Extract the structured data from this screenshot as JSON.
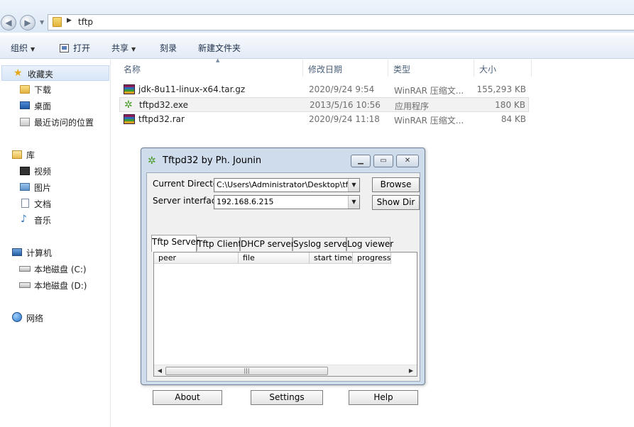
{
  "address": {
    "breadcrumb": "tftp",
    "folder_icon": "folder-icon"
  },
  "toolbar": {
    "organize": "组织",
    "open": "打开",
    "share": "共享",
    "burn": "刻录",
    "new_folder": "新建文件夹"
  },
  "sidebar": {
    "favorites": {
      "label": "收藏夹",
      "icon": "star-icon"
    },
    "favorites_items": [
      {
        "label": "下载",
        "icon": "downloads-folder-icon"
      },
      {
        "label": "桌面",
        "icon": "desktop-icon"
      },
      {
        "label": "最近访问的位置",
        "icon": "recent-places-icon"
      }
    ],
    "libraries": {
      "label": "库",
      "icon": "library-icon"
    },
    "library_items": [
      {
        "label": "视频",
        "icon": "video-icon"
      },
      {
        "label": "图片",
        "icon": "pictures-icon"
      },
      {
        "label": "文档",
        "icon": "documents-icon"
      },
      {
        "label": "音乐",
        "icon": "music-icon"
      }
    ],
    "computer": {
      "label": "计算机",
      "icon": "computer-icon"
    },
    "computer_items": [
      {
        "label": "本地磁盘 (C:)",
        "icon": "drive-c-icon"
      },
      {
        "label": "本地磁盘 (D:)",
        "icon": "drive-d-icon"
      }
    ],
    "network": {
      "label": "网络",
      "icon": "network-icon"
    }
  },
  "file_list": {
    "columns": {
      "name": "名称",
      "date": "修改日期",
      "type": "类型",
      "size": "大小"
    },
    "files": [
      {
        "name": "jdk-8u11-linux-x64.tar.gz",
        "date": "2020/9/24 9:54",
        "type": "WinRAR 压缩文...",
        "size": "155,293 KB",
        "icon": "winrar-archive-icon"
      },
      {
        "name": "tftpd32.exe",
        "date": "2013/5/16 10:56",
        "type": "应用程序",
        "size": "180 KB",
        "icon": "tftpd32-exe-icon"
      },
      {
        "name": "tftpd32.rar",
        "date": "2020/9/24 11:18",
        "type": "WinRAR 压缩文...",
        "size": "84 KB",
        "icon": "winrar-archive-icon"
      }
    ]
  },
  "dialog": {
    "title": "Tftpd32 by Ph. Jounin",
    "current_directory_label": "Current Directory",
    "current_directory_value": "C:\\Users\\Administrator\\Desktop\\tftp",
    "server_interface_label": "Server interface",
    "server_interface_value": "192.168.6.215",
    "browse": "Browse",
    "show_dir": "Show Dir",
    "tabs": [
      "Tftp Server",
      "Tftp Client",
      "DHCP server",
      "Syslog server",
      "Log viewer"
    ],
    "active_tab": "Tftp Server",
    "list_columns": [
      "peer",
      "file",
      "start time",
      "progress"
    ],
    "about": "About",
    "settings": "Settings",
    "help": "Help"
  }
}
